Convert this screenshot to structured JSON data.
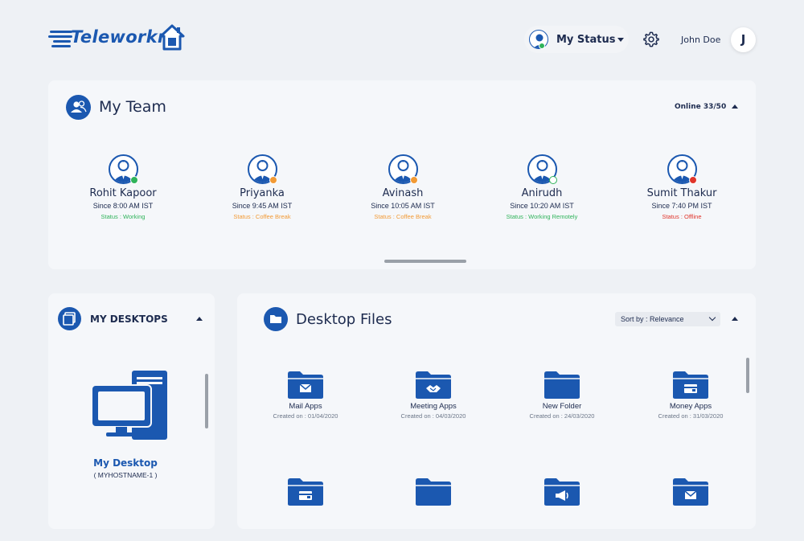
{
  "app": {
    "logo_text": "Teleworkr"
  },
  "header": {
    "status_label": "My Status",
    "user_name": "John Doe",
    "user_initial": "J"
  },
  "team": {
    "title": "My Team",
    "online_text": "Online 33/50",
    "members": [
      {
        "name": "Rohit Kapoor",
        "since": "Since 8:00 AM IST",
        "status": "Status : Working",
        "status_color": "#2fb35a",
        "dot_color": "#2fb35a"
      },
      {
        "name": "Priyanka",
        "since": "Since 9:45 AM IST",
        "status": "Status : Coffee Break",
        "status_color": "#f29a35",
        "dot_color": "#f29a35"
      },
      {
        "name": "Avinash",
        "since": "Since 10:05 AM IST",
        "status": "Status : Coffee Break",
        "status_color": "#f29a35",
        "dot_color": "#f29a35"
      },
      {
        "name": "Anirudh",
        "since": "Since 10:20 AM IST",
        "status": "Status : Working Remotely",
        "status_color": "#2fb35a",
        "dot_color": "#ffffff"
      },
      {
        "name": "Sumit Thakur",
        "since": "Since 7:40 PM IST",
        "status": "Status : Offline",
        "status_color": "#e0352b",
        "dot_color": "#e0352b"
      }
    ]
  },
  "desktops": {
    "title": "MY DESKTOPS",
    "items": [
      {
        "name": "My Desktop",
        "host": "( MYHOSTNAME-1 )"
      }
    ]
  },
  "files": {
    "title": "Desktop Files",
    "sort_label": "Sort by : Relevance",
    "items": [
      {
        "name": "Mail Apps",
        "date": "Created on : 01/04/2020",
        "icon": "mail-folder-icon"
      },
      {
        "name": "Meeting Apps",
        "date": "Created on : 04/03/2020",
        "icon": "handshake-folder-icon"
      },
      {
        "name": "New Folder",
        "date": "Created on : 24/03/2020",
        "icon": "folder-icon"
      },
      {
        "name": "Money Apps",
        "date": "Created on : 31/03/2020",
        "icon": "wallet-folder-icon"
      },
      {
        "name": "",
        "date": "",
        "icon": "card-folder-icon"
      },
      {
        "name": "",
        "date": "",
        "icon": "folder-icon"
      },
      {
        "name": "",
        "date": "",
        "icon": "megaphone-folder-icon"
      },
      {
        "name": "",
        "date": "",
        "icon": "mail-folder-icon"
      }
    ]
  },
  "colors": {
    "brand": "#1b58b0",
    "text": "#1d2b4f",
    "background": "#eef1f5",
    "panel": "#f5f7fa"
  }
}
